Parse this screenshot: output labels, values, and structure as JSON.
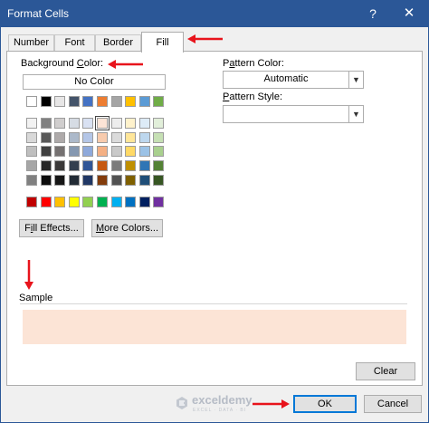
{
  "window": {
    "title": "Format Cells",
    "help_glyph": "?",
    "close_glyph": "✕"
  },
  "tabs": [
    {
      "label": "Number",
      "active": false
    },
    {
      "label": "Font",
      "active": false
    },
    {
      "label": "Border",
      "active": false
    },
    {
      "label": "Fill",
      "active": true
    }
  ],
  "background_color": {
    "label_pre": "Background ",
    "label_key": "C",
    "label_post": "olor:",
    "no_color_label": "No Color",
    "selected_color": "#fce4d6",
    "swatch_rows": [
      [
        "#ffffff",
        "#000000",
        "#e7e6e6",
        "#44546a",
        "#4472c4",
        "#ed7d31",
        "#a5a5a5",
        "#ffc000",
        "#5b9bd5",
        "#70ad47"
      ],
      [
        "#f2f2f2",
        "#808080",
        "#d0cece",
        "#d6dce4",
        "#d9e1f2",
        "#fce4d6",
        "#ededed",
        "#fff2cc",
        "#ddebf7",
        "#e2efda"
      ],
      [
        "#d9d9d9",
        "#595959",
        "#aeaaaa",
        "#acb9ca",
        "#b4c6e7",
        "#f8cbad",
        "#dbdbdb",
        "#ffe699",
        "#bdd7ee",
        "#c6e0b4"
      ],
      [
        "#bfbfbf",
        "#404040",
        "#757171",
        "#8497b0",
        "#8ea9db",
        "#f4b084",
        "#c9c9c9",
        "#ffd966",
        "#9bc2e6",
        "#a9d08e"
      ],
      [
        "#a6a6a6",
        "#262626",
        "#3a3838",
        "#333f4f",
        "#2f5597",
        "#c65911",
        "#7b7b7b",
        "#bf8f00",
        "#2f75b5",
        "#548235"
      ],
      [
        "#808080",
        "#0d0d0d",
        "#161616",
        "#222b35",
        "#203764",
        "#833c0c",
        "#525252",
        "#7f6000",
        "#1f4e78",
        "#375623"
      ]
    ],
    "standard_colors": [
      "#c00000",
      "#ff0000",
      "#ffc000",
      "#ffff00",
      "#92d050",
      "#00b050",
      "#00b0f0",
      "#0070c0",
      "#002060",
      "#7030a0"
    ]
  },
  "buttons": {
    "fill_effects": {
      "key": "i",
      "pre": "F",
      "post": "ll Effects..."
    },
    "more_colors": {
      "key": "M",
      "pre": "",
      "post": "ore Colors..."
    },
    "clear": {
      "label": "Clear"
    },
    "ok": {
      "label": "OK"
    },
    "cancel": {
      "label": "Cancel"
    }
  },
  "pattern_color": {
    "label_pre": "P",
    "label_key": "a",
    "label_post": "ttern Color:",
    "value": "Automatic"
  },
  "pattern_style": {
    "label_pre": "",
    "label_key": "P",
    "label_post": "attern Style:",
    "value": ""
  },
  "sample": {
    "label": "Sample"
  },
  "watermark": {
    "brand": "exceldemy",
    "tagline": "EXCEL · DATA · BI"
  },
  "accent_color": "#2b5797",
  "annotation_color": "#e8141c"
}
